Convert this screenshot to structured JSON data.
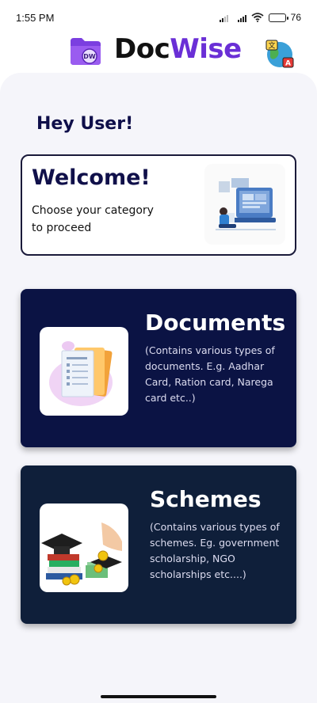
{
  "status_bar": {
    "time": "1:55 PM",
    "battery_percent": "76",
    "battery_level": 0.76,
    "icons": [
      "signal-icon",
      "signal-icon",
      "wifi-icon",
      "battery-icon"
    ]
  },
  "header": {
    "title_part1": "Doc",
    "title_part2": "Wise",
    "logo_text": "DW",
    "logo_icon": "folder-logo-icon",
    "translate_icon": "language-translate-icon"
  },
  "greeting": "Hey User!",
  "welcome": {
    "title": "Welcome!",
    "subtitle": "Choose your category\n to proceed",
    "image": "person-at-computer-illustration"
  },
  "categories": [
    {
      "title": "Documents",
      "description": "(Contains various types of documents. E.g. Aadhar Card, Ration card, Narega card etc..)",
      "image": "documents-folder-illustration"
    },
    {
      "title": "Schemes",
      "description": "(Contains various types of schemes. Eg. government scholarship, NGO scholarships etc....)",
      "image": "scholarship-graduation-illustration"
    }
  ],
  "colors": {
    "brand_purple": "#6a2fd6",
    "documents_card": "#0b1344",
    "schemes_card": "#0f1f3a",
    "heading": "#0f0f4a"
  }
}
